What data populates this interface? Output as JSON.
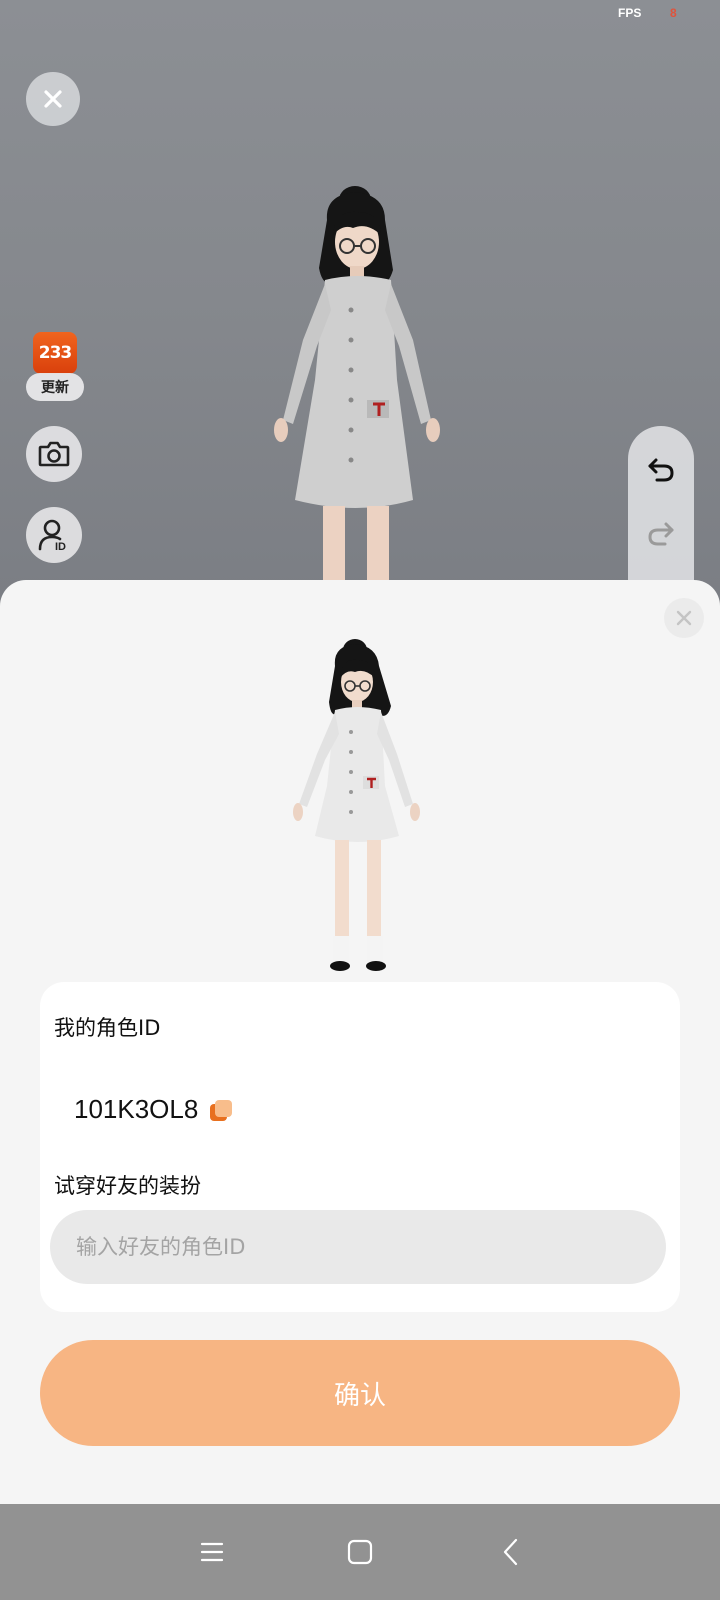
{
  "status": {
    "fps_label": "FPS",
    "fps_value": "8"
  },
  "scene": {
    "app_badge": {
      "logo_text": "233",
      "label": "更新"
    },
    "icons": {
      "close": "close-icon",
      "camera": "camera-icon",
      "role_id": "user-id-icon",
      "undo": "undo-icon",
      "redo": "redo-icon"
    }
  },
  "sheet": {
    "my_role_id_label": "我的角色ID",
    "my_role_id_value": "101K3OL8",
    "try_outfit_label": "试穿好友的装扮",
    "friend_input": {
      "value": "",
      "placeholder": "输入好友的角色ID"
    },
    "confirm_label": "确认"
  },
  "colors": {
    "accent": "#f7b583",
    "brand": "#e65a1a",
    "sheet_bg": "#f5f5f5",
    "navbar_bg": "#929292"
  },
  "navbar": {
    "icons": [
      "menu-icon",
      "home-icon",
      "back-icon"
    ]
  }
}
